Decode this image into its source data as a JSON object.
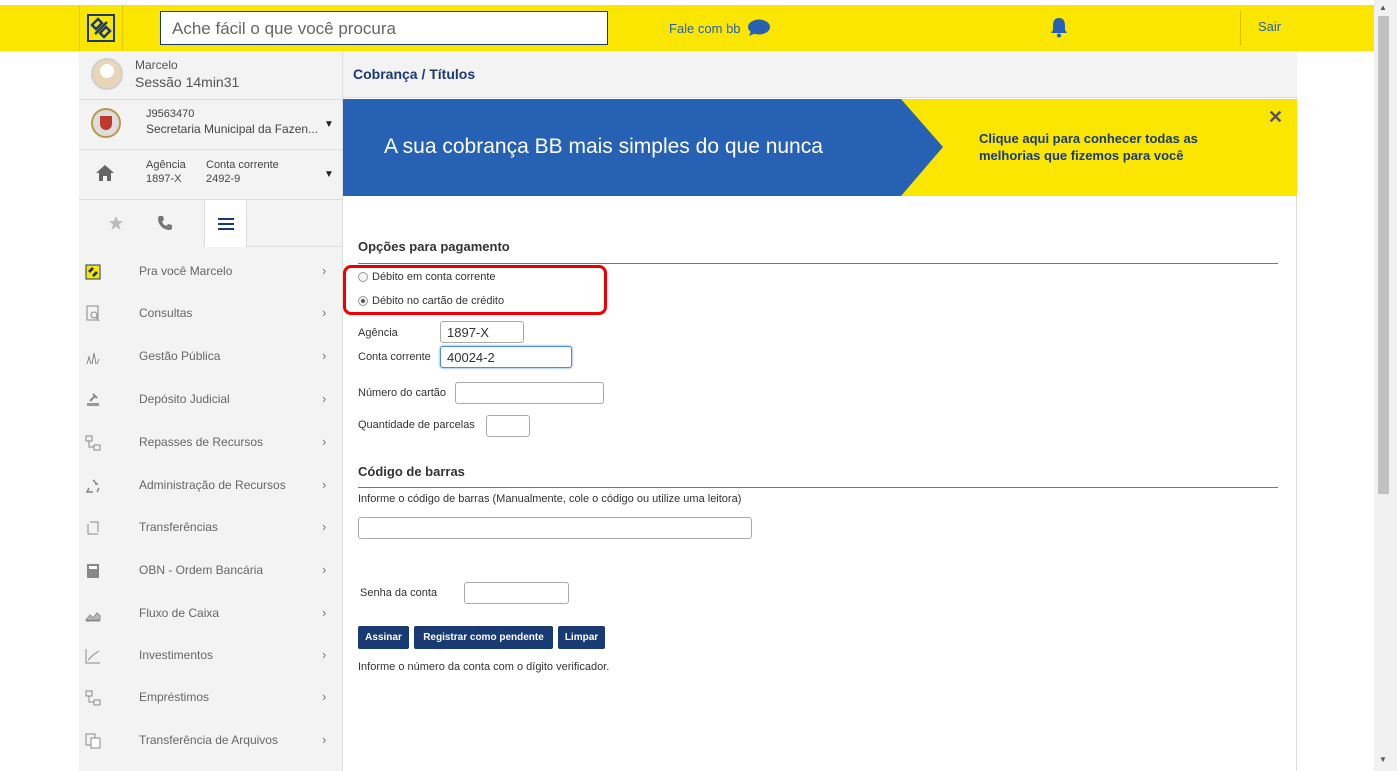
{
  "topbar": {
    "search_placeholder": "Ache fácil o que você procura",
    "fale_com": "Fale com bb",
    "sair": "Sair",
    "brand_color": "#fae600",
    "navy": "#1a3a73"
  },
  "sidebar": {
    "user_name": "Marcelo",
    "session": "Sessão 14min31",
    "org_code": "J9563470",
    "org_name": "Secretaria Municipal da Fazen...",
    "agencia_label": "Agência",
    "agencia_value": "1897-X",
    "conta_label": "Conta corrente",
    "conta_value": "2492-9",
    "menu": [
      {
        "label": "Pra você Marcelo",
        "icon": "bb-logo-icon"
      },
      {
        "label": "Consultas",
        "icon": "document-search-icon"
      },
      {
        "label": "Gestão Pública",
        "icon": "chart-building-icon"
      },
      {
        "label": "Depósito Judicial",
        "icon": "gavel-icon"
      },
      {
        "label": "Repasses de Recursos",
        "icon": "flow-icon"
      },
      {
        "label": "Administração de Recursos",
        "icon": "recycle-icon"
      },
      {
        "label": "Transferências",
        "icon": "transfer-icon"
      },
      {
        "label": "OBN - Ordem Bancária",
        "icon": "calculator-icon"
      },
      {
        "label": "Fluxo de Caixa",
        "icon": "area-chart-icon"
      },
      {
        "label": "Investimentos",
        "icon": "line-chart-icon"
      },
      {
        "label": "Empréstimos",
        "icon": "flow-icon"
      },
      {
        "label": "Transferência de Arquivos",
        "icon": "files-icon"
      }
    ]
  },
  "main": {
    "title": "Cobrança / Títulos",
    "banner_text": "A sua cobrança BB mais simples do que nunca",
    "banner_cta_line1": "Clique aqui para conhecer todas as",
    "banner_cta_line2": "melhorias que fizemos para você",
    "payment_title": "Opções para pagamento",
    "radio_debito_conta": "Débito em conta corrente",
    "radio_debito_cartao": "Débito no cartão de crédito",
    "agencia_label": "Agência",
    "agencia_value": "1897-X",
    "conta_label": "Conta corrente",
    "conta_value": "40024-2",
    "cartao_label": "Número do cartão",
    "parcelas_label": "Quantidade de parcelas",
    "barcode_title": "Código de barras",
    "barcode_help": "Informe o código de barras (Manualmente, cole o código ou utilize uma leitora)",
    "senha_label": "Senha da conta",
    "btn_assinar": "Assinar",
    "btn_registrar": "Registrar como pendente",
    "btn_limpar": "Limpar",
    "footer_hint": "Informe o número da conta com o dígito verificador."
  }
}
